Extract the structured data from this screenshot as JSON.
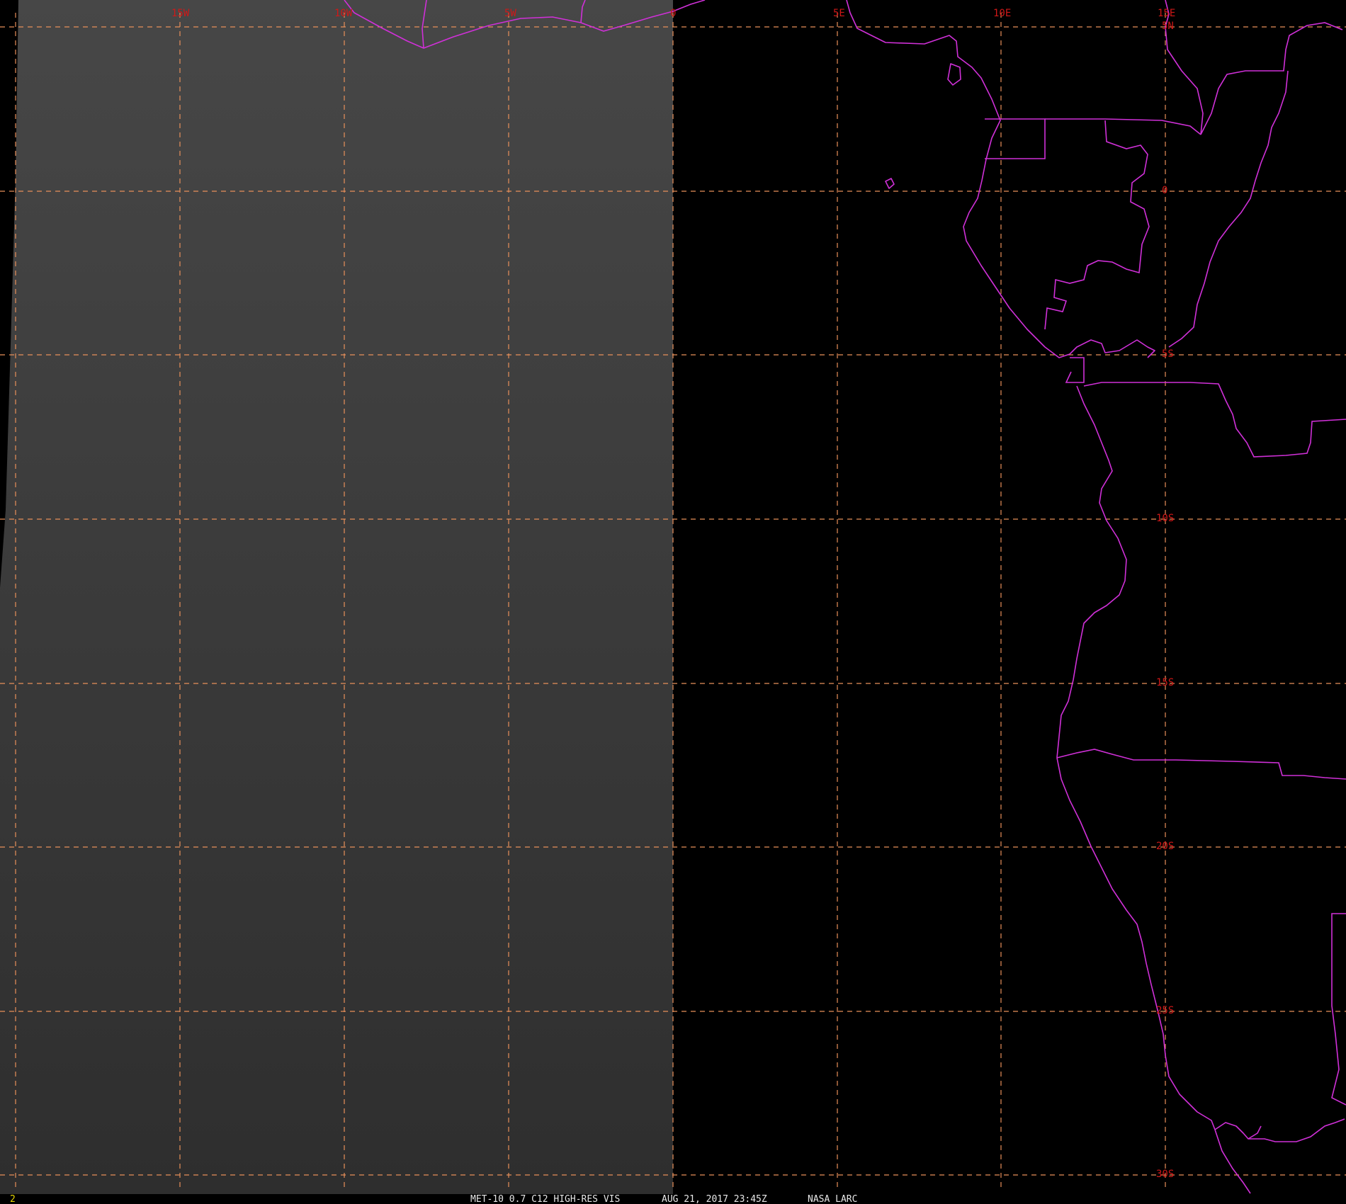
{
  "lon_labels": [
    "15W",
    "10W",
    "5W",
    "0",
    "5E",
    "10E",
    "15E"
  ],
  "lat_labels": [
    "5N",
    "0",
    "5S",
    "10S",
    "15S",
    "20S",
    "25S",
    "30S"
  ],
  "footer": {
    "frame_number": "2",
    "product": "MET-10 0.7 C12 HIGH-RES VIS",
    "timestamp": "AUG 21, 2017 23:45Z",
    "source": "NASA LARC"
  },
  "colors": {
    "grid": "#e8905a",
    "grid_labels": "#d01818",
    "political_boundaries": "#d030d8",
    "daylit_imagery": "#3a3a3a",
    "night_side": "#000000",
    "frame_number": "#e8d800"
  },
  "icons": {
    "map_layer": "satellite-visible-imagery"
  }
}
